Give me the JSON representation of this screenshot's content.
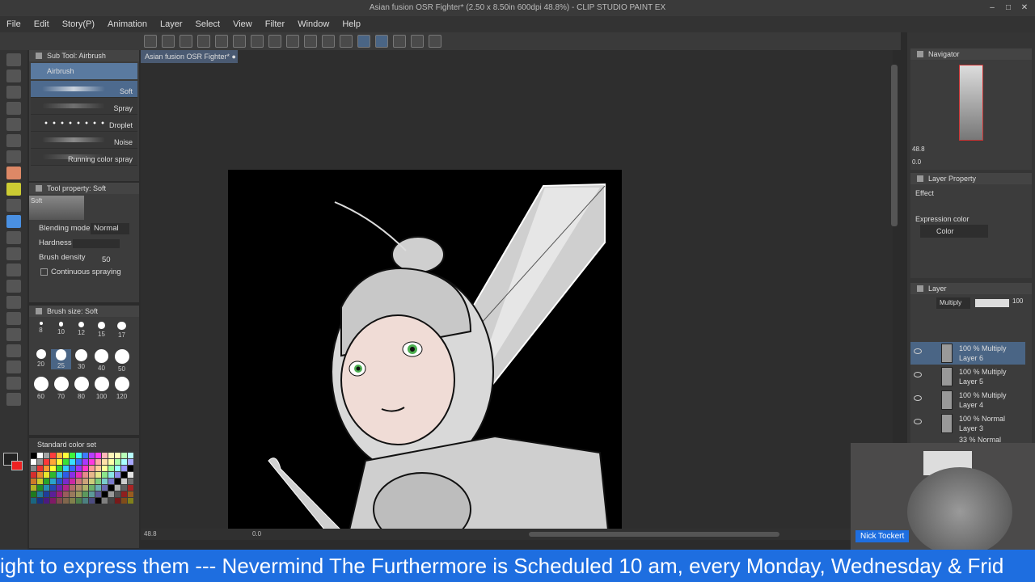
{
  "window": {
    "title": "Asian fusion OSR Fighter* (2.50 x 8.50in 600dpi 48.8%) - CLIP STUDIO PAINT EX"
  },
  "menu": [
    "File",
    "Edit",
    "Story(P)",
    "Animation",
    "Layer",
    "Select",
    "View",
    "Filter",
    "Window",
    "Help"
  ],
  "subtool": {
    "header": "Sub Tool: Airbrush",
    "group": "Airbrush",
    "items": [
      "Soft",
      "Spray",
      "Droplet",
      "Noise",
      "Running color spray"
    ]
  },
  "toolprop": {
    "header": "Tool property: Soft",
    "preset": "Soft",
    "blending_label": "Blending mode",
    "blending_value": "Normal",
    "hardness_label": "Hardness",
    "density_label": "Brush density",
    "density_value": "50",
    "continuous_label": "Continuous spraying"
  },
  "brushsize": {
    "header": "Brush size: Soft",
    "sizes": [
      "8",
      "10",
      "12",
      "15",
      "17",
      "20",
      "25",
      "30",
      "40",
      "50",
      "60",
      "70",
      "80",
      "100",
      "120"
    ]
  },
  "colorset": {
    "label": "Standard color set"
  },
  "document": {
    "tab": "Asian fusion OSR Fighter*"
  },
  "status": {
    "zoom": "48.8",
    "angle": "0.0"
  },
  "navigator": {
    "title": "Navigator",
    "zoom": "48.8",
    "angle": "0.0"
  },
  "layerprop": {
    "title": "Layer Property",
    "effect_label": "Effect",
    "expression_label": "Expression color",
    "expression_value": "Color"
  },
  "layers": {
    "title": "Layer",
    "blend": "Multiply",
    "opacity": "100",
    "items": [
      {
        "mode": "100 % Multiply",
        "name": "Layer 6"
      },
      {
        "mode": "100 % Multiply",
        "name": "Layer 5"
      },
      {
        "mode": "100 % Multiply",
        "name": "Layer 4"
      },
      {
        "mode": "100 % Normal",
        "name": "Layer 3"
      },
      {
        "mode": "33 % Normal",
        "name": ""
      }
    ]
  },
  "webcam": {
    "name": "Nick Tockert"
  },
  "ticker": {
    "text": "ight to express them --- Nevermind The Furthermore is Scheduled 10 am, every Monday, Wednesday & Frid"
  }
}
